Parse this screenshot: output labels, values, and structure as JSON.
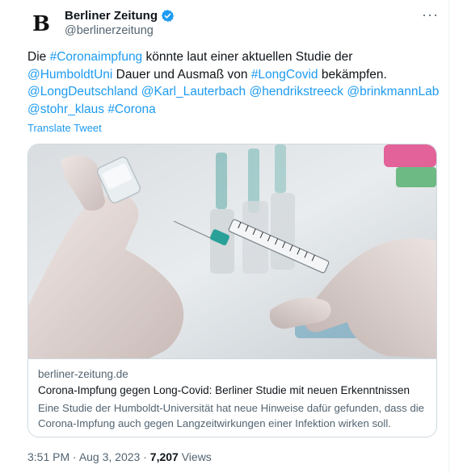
{
  "account": {
    "display_name": "Berliner Zeitung",
    "handle": "@berlinerzeitung",
    "avatar_letter": "B",
    "verified_color": "#1d9bf0",
    "more_glyph": "···"
  },
  "tweet": {
    "t0": "Die ",
    "t1": "#Coronaimpfung",
    "t2": " könnte laut einer aktuellen Studie der ",
    "t3": "@HumboldtUni",
    "t4": " Dauer und Ausmaß von ",
    "t5": "#LongCovid",
    "t6": " bekämpfen. ",
    "t7": "@LongDeutschland",
    "t8": " ",
    "t9": "@Karl_Lauterbach",
    "t10": " ",
    "t11": "@hendrikstreeck",
    "t12": " ",
    "t13": "@brinkmannLab",
    "t14": " ",
    "t15": "@stohr_klaus",
    "t16": " ",
    "t17": "#Corona",
    "translate_label": "Translate Tweet"
  },
  "card": {
    "domain": "berliner-zeitung.de",
    "title": "Corona-Impfung gegen Long-Covid: Berliner Studie mit neuen Erkenntnissen",
    "description": "Eine Studie der Humboldt-Universität hat neue Hinweise dafür gefunden, dass die Corona-Impfung auch gegen Langzeitwirkungen einer Infektion wirken soll."
  },
  "meta": {
    "time": "3:51 PM",
    "separator": " · ",
    "date": "Aug 3, 2023",
    "separator2": " · ",
    "views_count": "7,207",
    "views_label": " Views"
  },
  "colors": {
    "link": "#1d9bf0",
    "text": "#0f1419",
    "secondary": "#536471"
  }
}
